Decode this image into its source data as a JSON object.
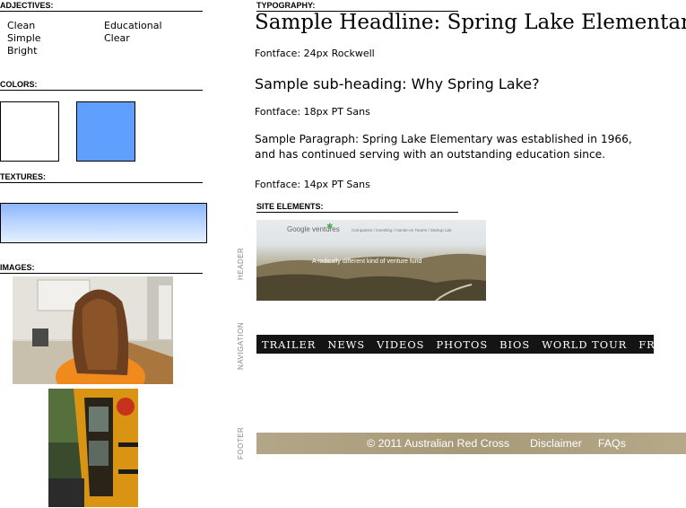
{
  "sections": {
    "adjectives": "ADJECTIVES:",
    "colors": "COLORS:",
    "textures": "TEXTURES:",
    "images": "IMAGES:",
    "typography": "TYPOGRAPHY:",
    "site_elements": "SITE ELEMENTS:"
  },
  "adjectives": {
    "col1": [
      "Clean",
      "Simple",
      "Bright"
    ],
    "col2": [
      "Educational",
      "Clear"
    ]
  },
  "colors": {
    "swatch1": "#ffffff",
    "swatch2": "#5fa0ff"
  },
  "typography": {
    "headline": "Sample Headline: Spring Lake Elementary",
    "headline_font": "Fontface: 24px Rockwell",
    "subheading": "Sample sub-heading: Why Spring Lake?",
    "subheading_font": "Fontface: 18px PT Sans",
    "paragraph": "Sample Paragraph:  Spring Lake Elementary was established in 1966, and has continued serving with an outstanding education since.",
    "paragraph_font": "Fontface: 14px PT Sans"
  },
  "side_labels": {
    "header": "HEADER",
    "navigation": "NAVIGATION",
    "footer": "FOOTER"
  },
  "header_example": {
    "logo": "Google ventures",
    "nav": "Companies  /  Investing  /  Hands-on Teams  /  Startup Lab",
    "tagline": "A radically different kind of venture fund"
  },
  "nav_example": [
    "TRAILER",
    "NEWS",
    "VIDEOS",
    "PHOTOS",
    "BIOS",
    "WORLD TOUR",
    "FRIENDS"
  ],
  "footer_example": {
    "copyright": "© 2011 Australian Red Cross",
    "disclaimer": "Disclaimer",
    "faqs": "FAQs"
  }
}
